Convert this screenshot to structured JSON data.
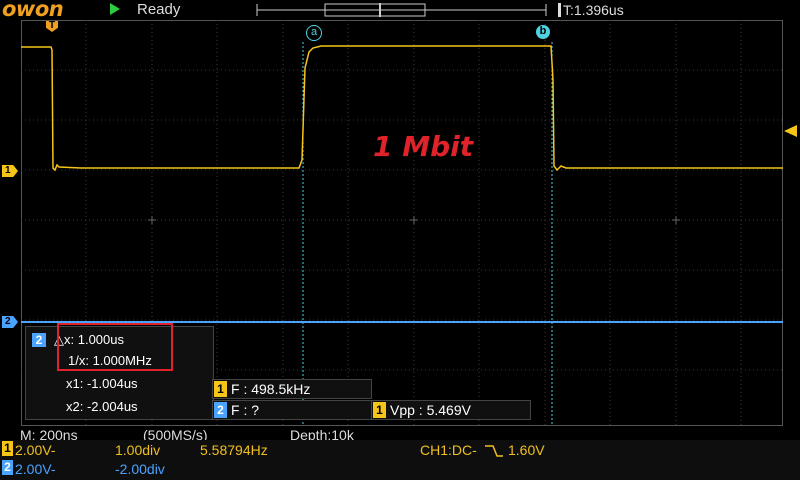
{
  "brand": {
    "logo": "owon"
  },
  "run_state": {
    "status": "Ready",
    "icon": "play-icon"
  },
  "trigger": {
    "position_label": "T:1.396us",
    "top_marker": "T"
  },
  "cursors": {
    "a_label": "a",
    "b_label": "b"
  },
  "annotation": {
    "text": "1 Mbit"
  },
  "channel_markers": {
    "ch1": "1",
    "ch2": "2"
  },
  "cursor_panel": {
    "channel": "2",
    "delta_x": "△x: 1.000us",
    "inv_x": "1/x: 1.000MHz",
    "x1": "x1: -1.004us",
    "x2": "x2: -2.004us"
  },
  "measurements": [
    {
      "channel": "1",
      "text": "F : 498.5kHz"
    },
    {
      "channel": "2",
      "text": "F :    ?"
    },
    {
      "channel": "1",
      "text": "Vpp : 5.469V"
    }
  ],
  "acquisition": {
    "timebase": "M: 200ns",
    "sample_rate": "(500MS/s)",
    "depth": "Depth:10k"
  },
  "channels": [
    {
      "badge": "1",
      "volts": "2.00V-",
      "offset": "1.00div",
      "freq": "5.58794Hz",
      "trigger": "CH1:DC-",
      "trigger_level": "1.60V"
    },
    {
      "badge": "2",
      "volts": "2.00V-",
      "offset": "-2.00div"
    }
  ],
  "colors": {
    "ch1": "#f5c518",
    "ch2": "#4aa3ff",
    "cursor": "#4ed2e0",
    "annotation": "#e0222a",
    "logo": "#f0a020"
  }
}
